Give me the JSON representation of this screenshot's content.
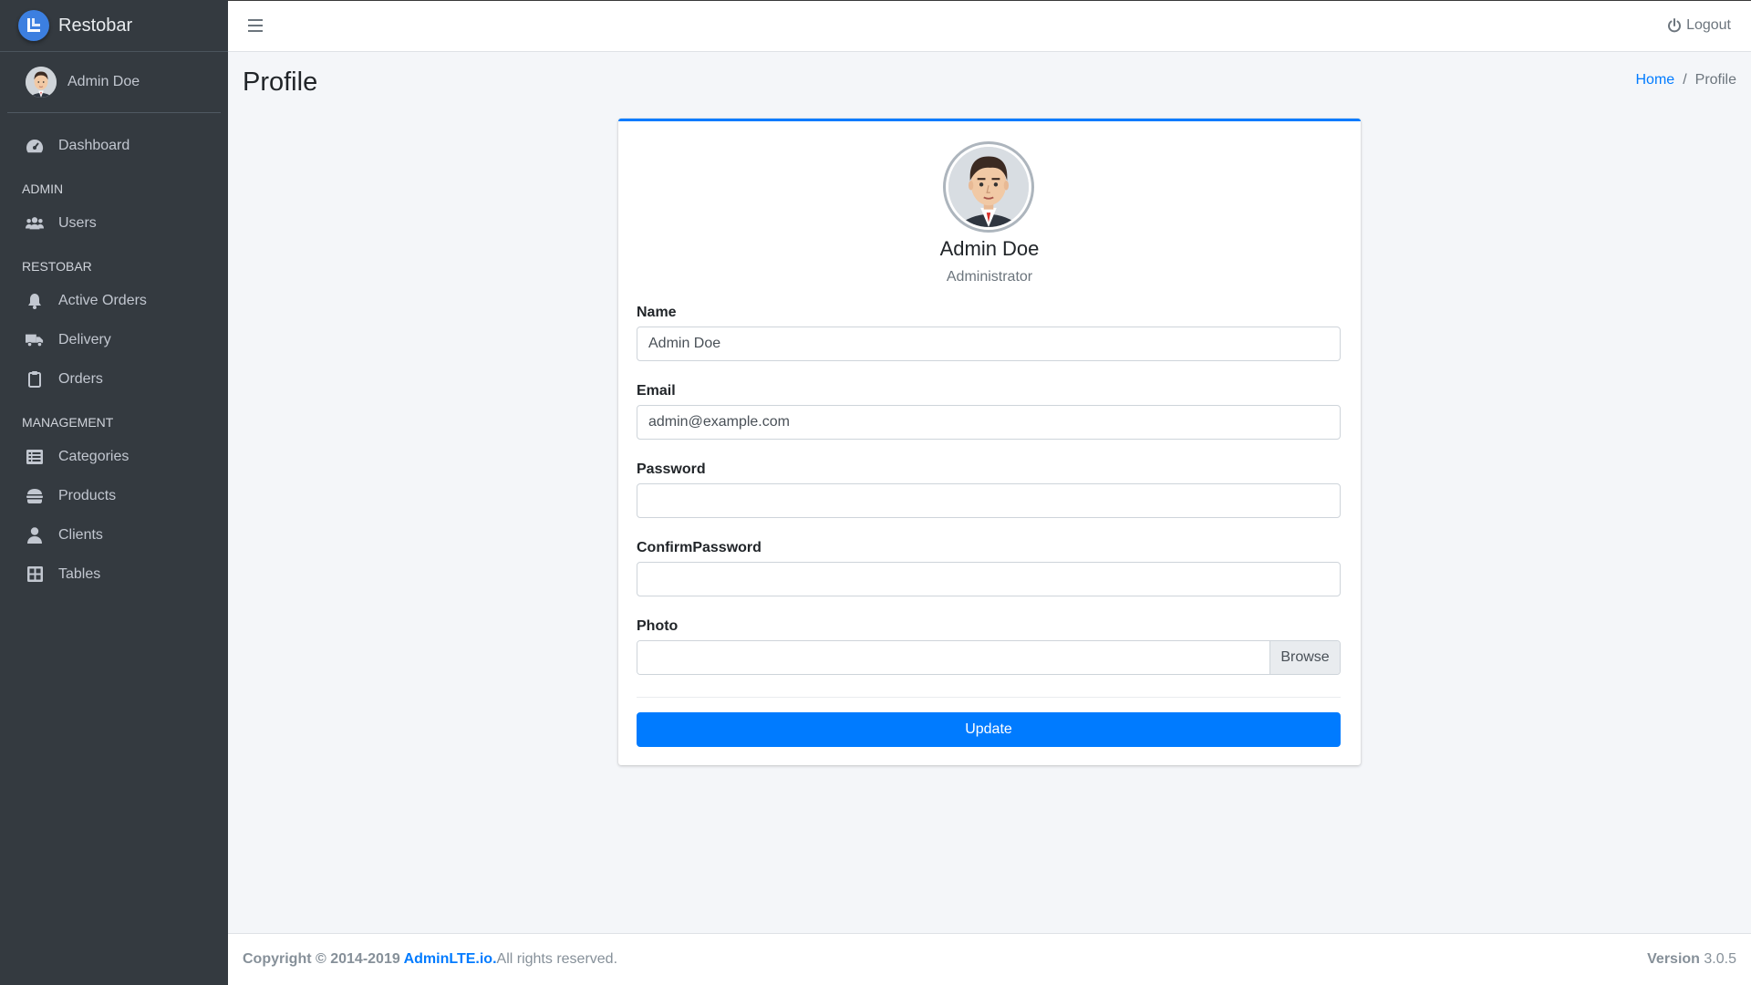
{
  "brand": {
    "name": "Restobar",
    "logo_icon": "adminlte-logo-icon"
  },
  "user": {
    "name": "Admin Doe",
    "role": "Administrator"
  },
  "sidebar": {
    "dashboard": "Dashboard",
    "header_admin": "ADMIN",
    "users": "Users",
    "header_restobar": "RESTOBAR",
    "active_orders": "Active Orders",
    "delivery": "Delivery",
    "orders": "Orders",
    "header_management": "MANAGEMENT",
    "categories": "Categories",
    "products": "Products",
    "clients": "Clients",
    "tables": "Tables"
  },
  "navbar": {
    "logout": "Logout"
  },
  "page": {
    "title": "Profile",
    "breadcrumb": {
      "home": "Home",
      "separator": "/",
      "current": "Profile"
    }
  },
  "form": {
    "name_label": "Name",
    "name_value": "Admin Doe",
    "email_label": "Email",
    "email_value": "admin@example.com",
    "password_label": "Password",
    "password_value": "",
    "confirm_label": "ConfirmPassword",
    "confirm_value": "",
    "photo_label": "Photo",
    "browse": "Browse",
    "submit": "Update"
  },
  "footer": {
    "copyright_prefix": "Copyright © 2014-2019 ",
    "link": "AdminLTE.io.",
    "rights": "All rights reserved.",
    "version_label": "Version",
    "version": "3.0.5"
  },
  "colors": {
    "primary": "#007bff",
    "sidebar_bg": "#343a40",
    "content_bg": "#f4f6f9"
  }
}
